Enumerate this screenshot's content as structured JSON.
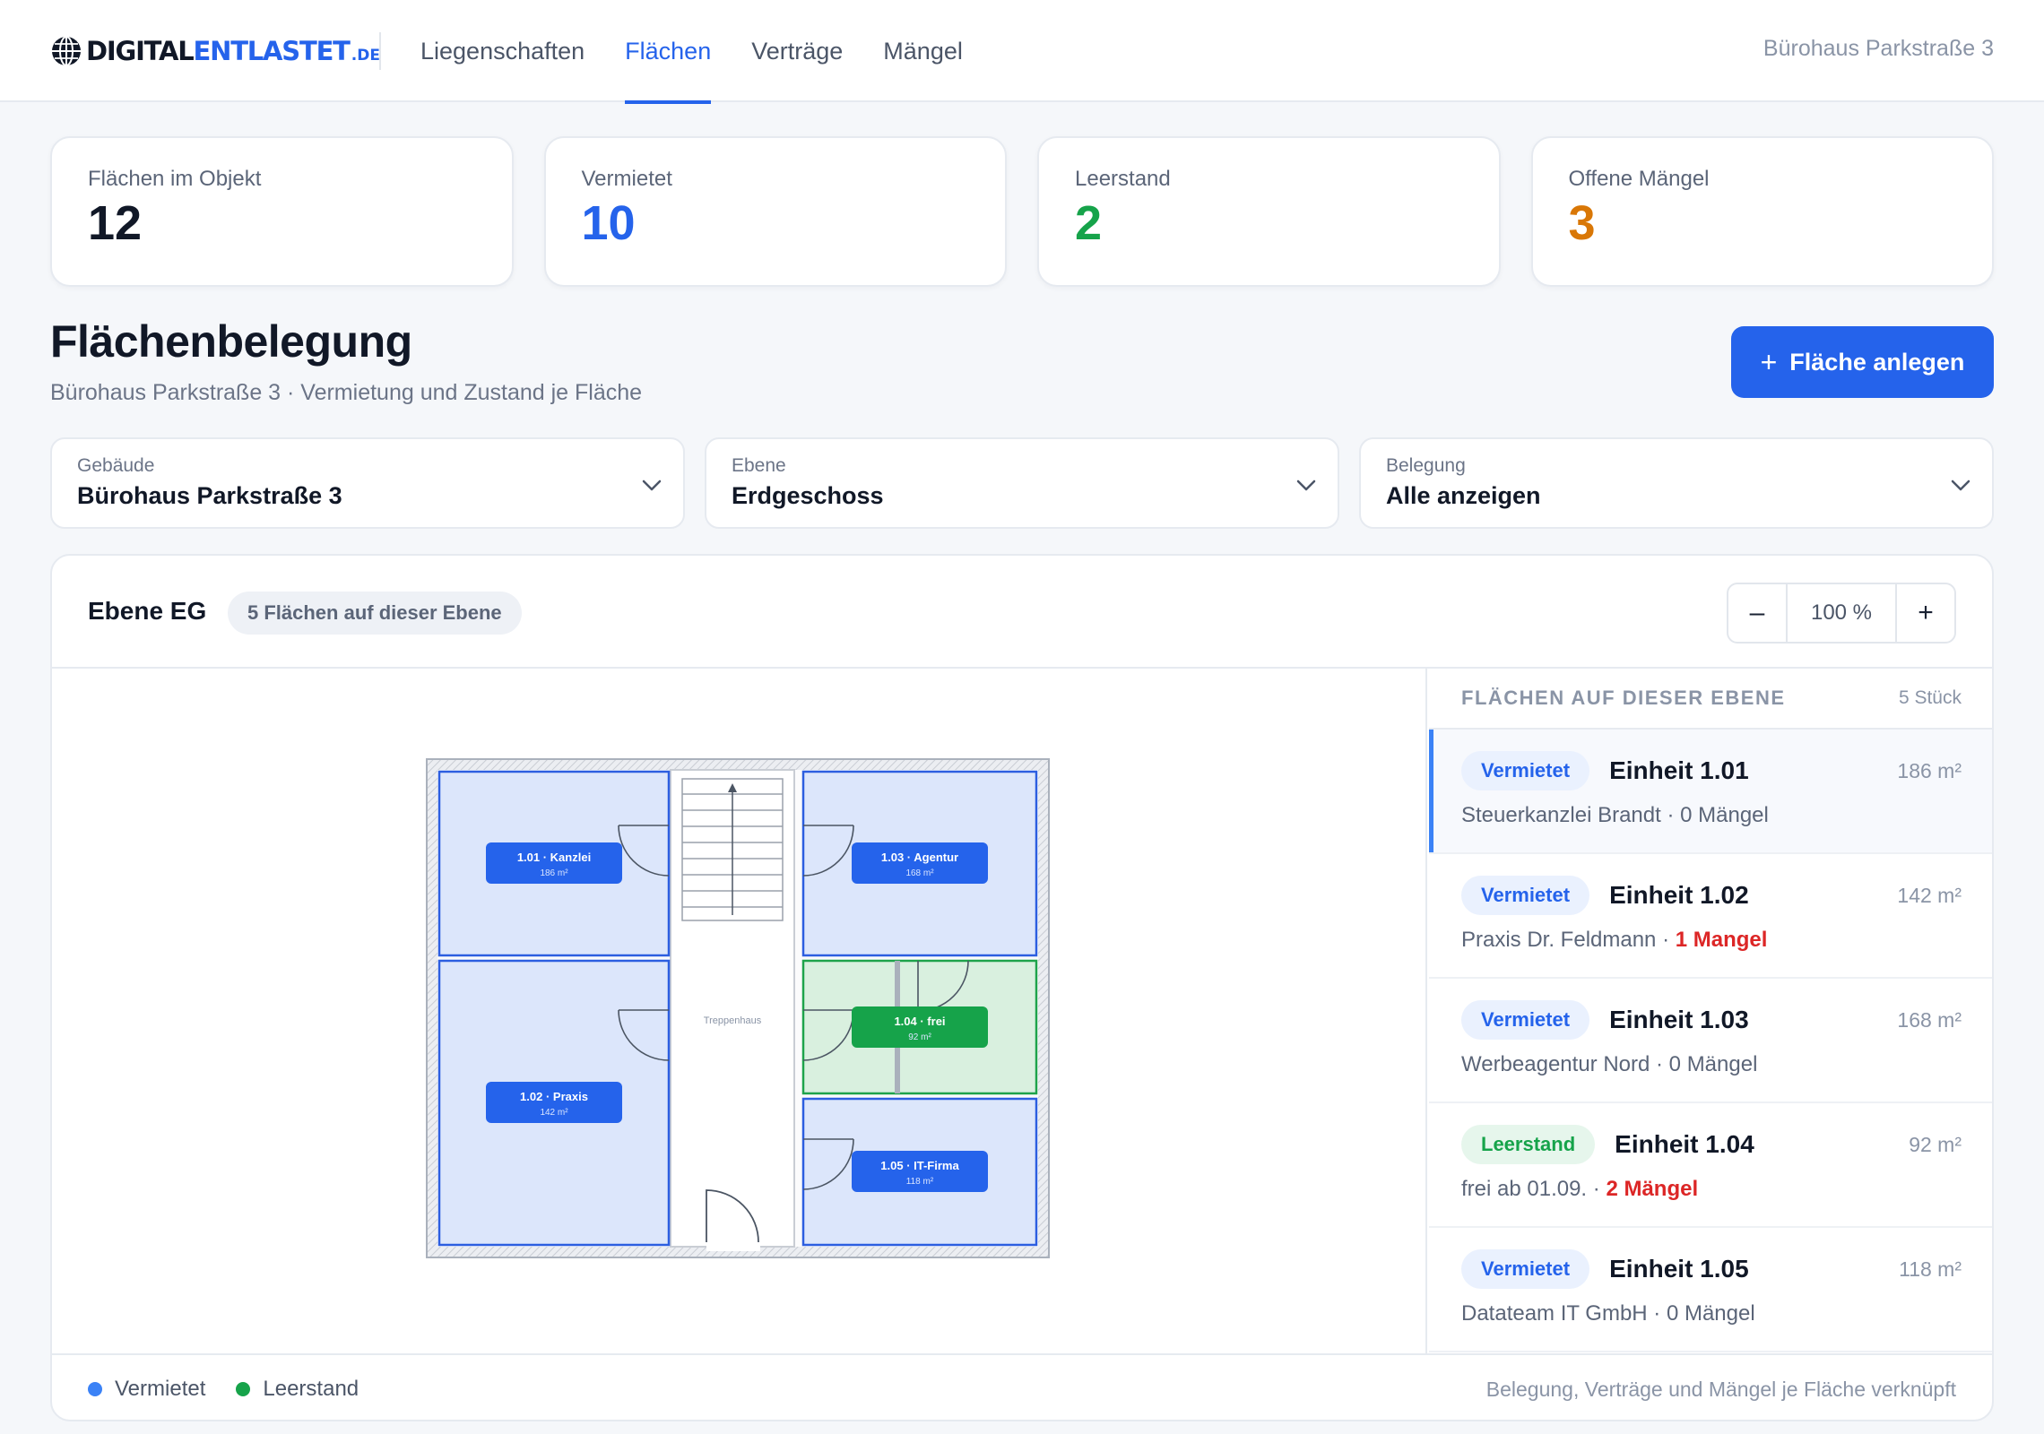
{
  "brand": {
    "part1": "DIGITAL",
    "part2": "ENTLASTET",
    "tld": ".DE"
  },
  "nav": [
    "Liegenschaften",
    "Flächen",
    "Verträge",
    "Mängel"
  ],
  "nav_active": "Flächen",
  "top_right": "Bürohaus Parkstraße 3",
  "stats": [
    {
      "label": "Flächen im Objekt",
      "value": "12",
      "color": "#111827"
    },
    {
      "label": "Vermietet",
      "value": "10",
      "color": "#2563eb"
    },
    {
      "label": "Leerstand",
      "value": "2",
      "color": "#16a34a"
    },
    {
      "label": "Offene Mängel",
      "value": "3",
      "color": "#d97706"
    }
  ],
  "page": {
    "title": "Flächenbelegung",
    "subtitle": "Bürohaus Parkstraße 3 · Vermietung und Zustand je Fläche",
    "add_button": "Fläche anlegen"
  },
  "filters": [
    {
      "label": "Gebäude",
      "value": "Bürohaus Parkstraße 3"
    },
    {
      "label": "Ebene",
      "value": "Erdgeschoss"
    },
    {
      "label": "Belegung",
      "value": "Alle anzeigen"
    }
  ],
  "panel": {
    "level": "Ebene EG",
    "level_chip": "5 Flächen auf dieser Ebene",
    "zoom_out": "–",
    "zoom": "100 %",
    "zoom_in": "+"
  },
  "floorplan": {
    "stairwell_label": "Treppenhaus",
    "rooms": [
      {
        "label": "1.01 · Kanzlei",
        "area": "186 m²",
        "status": "rented"
      },
      {
        "label": "1.02 · Praxis",
        "area": "142 m²",
        "status": "rented"
      },
      {
        "label": "1.03 · Agentur",
        "area": "168 m²",
        "status": "rented"
      },
      {
        "label": "1.04 · frei",
        "area": "92 m²",
        "status": "vacant"
      },
      {
        "label": "1.05 · IT-Firma",
        "area": "118 m²",
        "status": "rented"
      }
    ]
  },
  "unit_list": {
    "title": "FLÄCHEN AUF DIESER EBENE",
    "count": "5 Stück",
    "items": [
      {
        "status": "Vermietet",
        "name": "Einheit 1.01",
        "area": "186 m²",
        "tenant": "Steuerkanzlei Brandt · ",
        "defects": "0 Mängel",
        "defect_alert": false
      },
      {
        "status": "Vermietet",
        "name": "Einheit 1.02",
        "area": "142 m²",
        "tenant": "Praxis Dr. Feldmann · ",
        "defects": "1 Mangel",
        "defect_alert": true
      },
      {
        "status": "Vermietet",
        "name": "Einheit 1.03",
        "area": "168 m²",
        "tenant": "Werbeagentur Nord · ",
        "defects": "0 Mängel",
        "defect_alert": false
      },
      {
        "status": "Leerstand",
        "name": "Einheit 1.04",
        "area": "92 m²",
        "tenant": "frei ab 01.09. · ",
        "defects": "2 Mängel",
        "defect_alert": true
      },
      {
        "status": "Vermietet",
        "name": "Einheit 1.05",
        "area": "118 m²",
        "tenant": "Datateam IT GmbH · ",
        "defects": "0 Mängel",
        "defect_alert": false
      }
    ]
  },
  "legend": [
    {
      "label": "Vermietet",
      "color": "#3b82f6"
    },
    {
      "label": "Leerstand",
      "color": "#16a34a"
    }
  ],
  "footer_note": "Belegung, Verträge und Mängel je Fläche verknüpft",
  "icons": {
    "logo": "globe-icon",
    "add": "plus-icon",
    "select": "chevron-down-icon"
  }
}
